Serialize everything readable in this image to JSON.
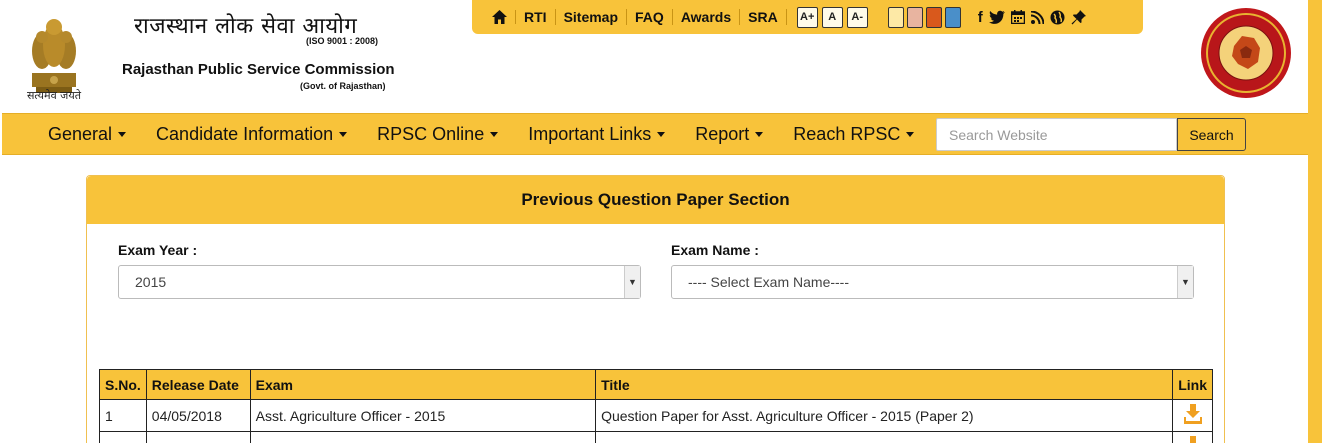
{
  "header": {
    "title_hindi": "राजस्थान लोक सेवा आयोग",
    "iso": "(ISO 9001 : 2008)",
    "title_english": "Rajasthan Public Service Commission",
    "govt": "(Govt. of Rajasthan)",
    "emblem_motto": "सत्यमेव जयते"
  },
  "topbar": {
    "home_icon": "home-icon",
    "links": [
      "RTI",
      "Sitemap",
      "FAQ",
      "Awards",
      "SRA"
    ],
    "font_sizes": [
      "A+",
      "A",
      "A-"
    ],
    "theme_colors": [
      "#fde9a6",
      "#e8b4a0",
      "#d9591c",
      "#4a8fc9"
    ],
    "social_icons": [
      "facebook-icon",
      "twitter-icon",
      "calendar-icon",
      "rss-icon",
      "globe-icon",
      "pin-icon"
    ]
  },
  "nav": {
    "items": [
      "General",
      "Candidate Information",
      "RPSC Online",
      "Important Links",
      "Report",
      "Reach RPSC"
    ],
    "search_placeholder": "Search Website",
    "search_label": "Search"
  },
  "panel": {
    "title": "Previous Question Paper Section",
    "exam_year_label": "Exam Year :",
    "exam_year_value": "2015",
    "exam_name_label": "Exam Name :",
    "exam_name_value": "---- Select Exam Name----"
  },
  "table": {
    "headers": [
      "S.No.",
      "Release Date",
      "Exam",
      "Title",
      "Link"
    ],
    "rows": [
      [
        "1",
        "04/05/2018",
        "Asst. Agriculture Officer - 2015",
        "Question Paper for Asst. Agriculture Officer - 2015 (Paper 2)"
      ],
      [
        "",
        "",
        "",
        ""
      ]
    ]
  },
  "colors": {
    "accent": "#f8c33a",
    "download_icon": "#f0a020"
  }
}
